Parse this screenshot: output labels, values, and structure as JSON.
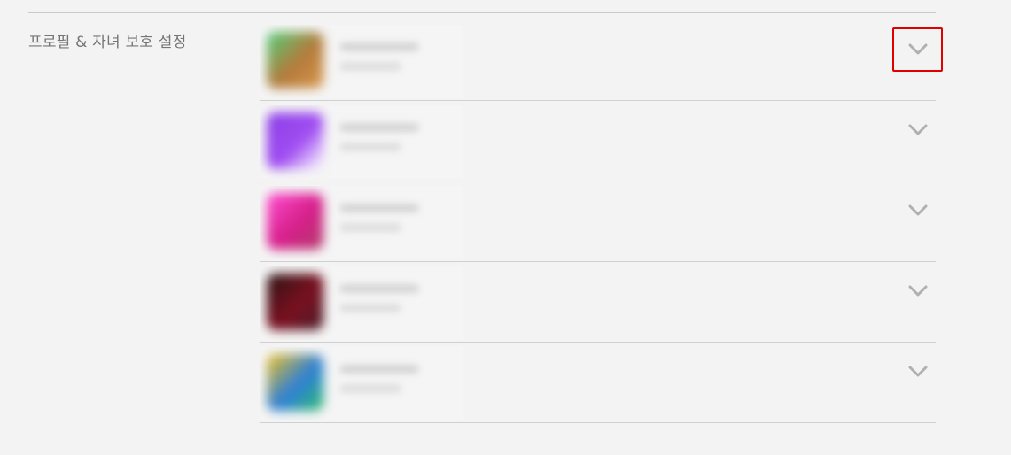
{
  "section": {
    "title": "프로필 & 자녀 보호 설정"
  },
  "profiles": [
    {
      "avatar_colors": [
        "#4fcf7a",
        "#b57a3b",
        "#d79a4d"
      ],
      "expand_icon": "chevron-down-icon",
      "highlighted": true
    },
    {
      "avatar_colors": [
        "#8b3ee6",
        "#a04df2",
        "#ffffff"
      ],
      "expand_icon": "chevron-down-icon",
      "highlighted": false
    },
    {
      "avatar_colors": [
        "#ff4fd2",
        "#d61f8a",
        "#b23b6a"
      ],
      "expand_icon": "chevron-down-icon",
      "highlighted": false
    },
    {
      "avatar_colors": [
        "#2a1414",
        "#7a1020",
        "#4a1e2a"
      ],
      "expand_icon": "chevron-down-icon",
      "highlighted": false
    },
    {
      "avatar_colors": [
        "#f2c21f",
        "#2d7fd8",
        "#2fbf6a"
      ],
      "expand_icon": "chevron-down-icon",
      "highlighted": false
    }
  ],
  "colors": {
    "background": "#f3f3f3",
    "divider": "#d0d0d0",
    "title_text": "#757575",
    "chevron": "#b0b0b0",
    "highlight_border": "#e00000"
  }
}
